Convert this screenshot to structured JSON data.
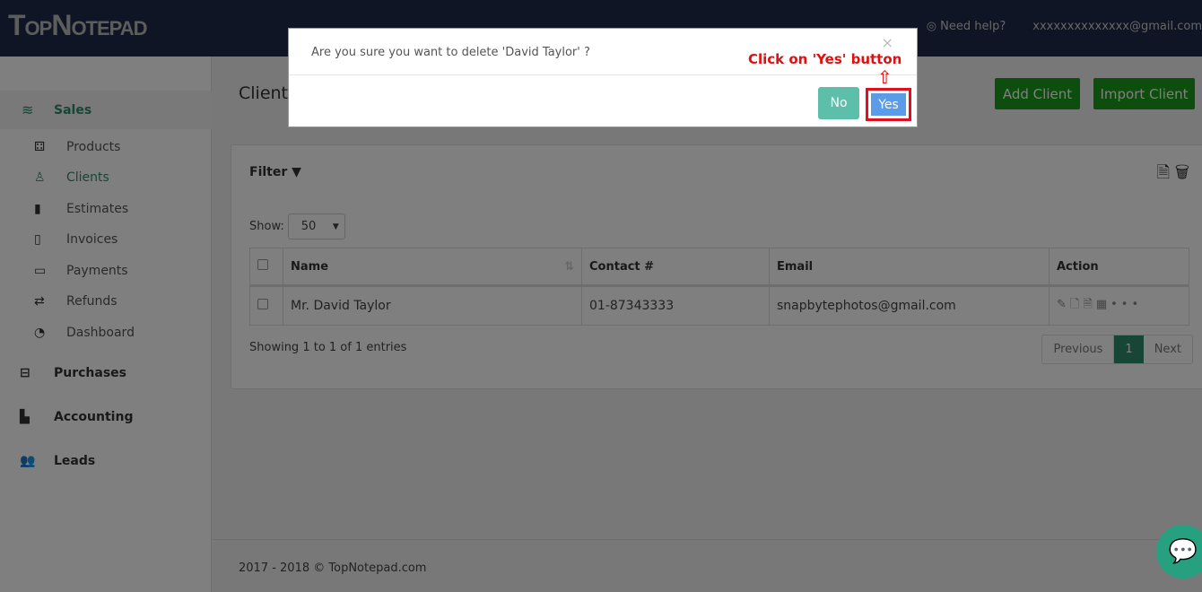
{
  "header": {
    "logo": "TopNotepad",
    "help": "Need help?",
    "user": "xxxxxxxxxxxxxx@gmail.com"
  },
  "sidebar": {
    "sales": "Sales",
    "items": [
      {
        "label": "Products",
        "icon": "cubes-icon"
      },
      {
        "label": "Clients",
        "icon": "user-icon"
      },
      {
        "label": "Estimates",
        "icon": "file-icon"
      },
      {
        "label": "Invoices",
        "icon": "file-o-icon"
      },
      {
        "label": "Payments",
        "icon": "credit-card-icon"
      },
      {
        "label": "Refunds",
        "icon": "exchange-icon"
      },
      {
        "label": "Dashboard",
        "icon": "dashboard-icon"
      }
    ],
    "groups": [
      "Purchases",
      "Accounting",
      "Leads"
    ]
  },
  "main": {
    "title": "Clients",
    "add_client": "Add Client",
    "import_client": "Import Client",
    "filter": "Filter",
    "show_label": "Show:",
    "show_value": "50",
    "table": {
      "headers": [
        "Name",
        "Contact #",
        "Email",
        "Action"
      ],
      "rows": [
        {
          "name": "Mr. David Taylor",
          "contact": "01-87343333",
          "email": "snapbytephotos@gmail.com"
        }
      ]
    },
    "info": "Showing 1 to 1 of 1 entries",
    "pager": {
      "prev": "Previous",
      "current": "1",
      "next": "Next"
    }
  },
  "footer": "2017 - 2018 © TopNotepad.com",
  "modal": {
    "question": "Are you sure you want to delete 'David Taylor' ?",
    "close": "×",
    "no": "No",
    "yes": "Yes",
    "annotation": "Click on 'Yes' button"
  },
  "colors": {
    "header": "#1e2a4a",
    "accent": "#2e8b6d",
    "green_button": "#1a9a1a",
    "yes": "#5b9be8",
    "no": "#5dbfa9",
    "annotation": "#e01010"
  }
}
